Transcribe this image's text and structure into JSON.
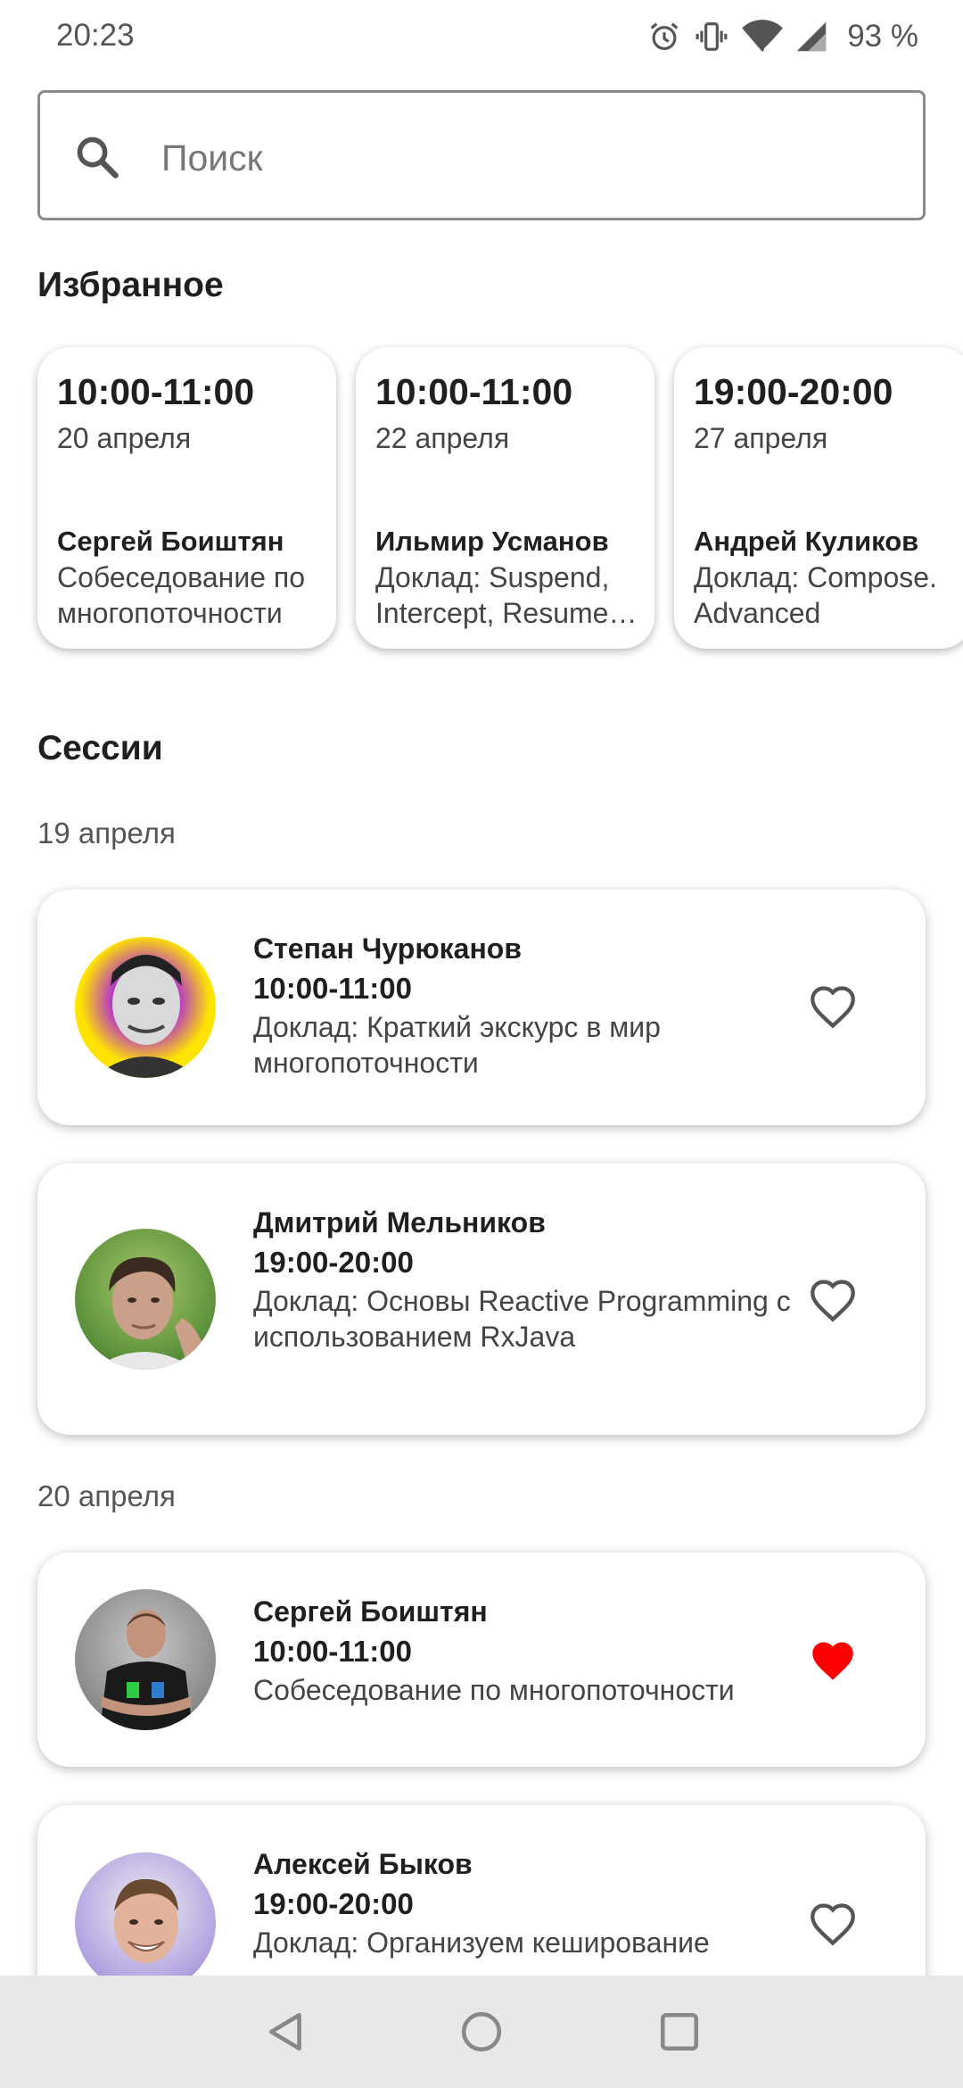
{
  "status_bar": {
    "time": "20:23",
    "battery": "93 %"
  },
  "search": {
    "placeholder": "Поиск"
  },
  "favorites": {
    "title": "Избранное",
    "cards": [
      {
        "time": "10:00-11:00",
        "date": "20 апреля",
        "speaker": "Сергей Боиштян",
        "description": "Собеседование по многопоточности"
      },
      {
        "time": "10:00-11:00",
        "date": "22 апреля",
        "speaker": "Ильмир Усманов",
        "description": "Доклад: Suspend, Intercept, Resume - три шага асинхр..."
      },
      {
        "time": "19:00-20:00",
        "date": "27 апреля",
        "speaker": "Андрей Куликов",
        "description": "Доклад: Compose. Advanced"
      }
    ]
  },
  "sessions": {
    "title": "Сессии",
    "groups": [
      {
        "date": "19 апреля",
        "items": [
          {
            "speaker": "Степан Чурюканов",
            "time": "10:00-11:00",
            "description": "Доклад: Краткий экскурс в мир многопоточности",
            "favorite": false
          },
          {
            "speaker": "Дмитрий Мельников",
            "time": "19:00-20:00",
            "description": "Доклад: Основы Reactive Programming с использованием RxJava",
            "favorite": false
          }
        ]
      },
      {
        "date": "20 апреля",
        "items": [
          {
            "speaker": "Сергей Боиштян",
            "time": "10:00-11:00",
            "description": "Собеседование по многопоточности",
            "favorite": true
          },
          {
            "speaker": "Алексей Быков",
            "time": "19:00-20:00",
            "description": "Доклад: Организуем кеширование",
            "favorite": false
          }
        ]
      }
    ]
  },
  "colors": {
    "heart_active": "#ff0000",
    "heart_inactive": "#555555",
    "nav_bar": "#e8e8e8"
  }
}
